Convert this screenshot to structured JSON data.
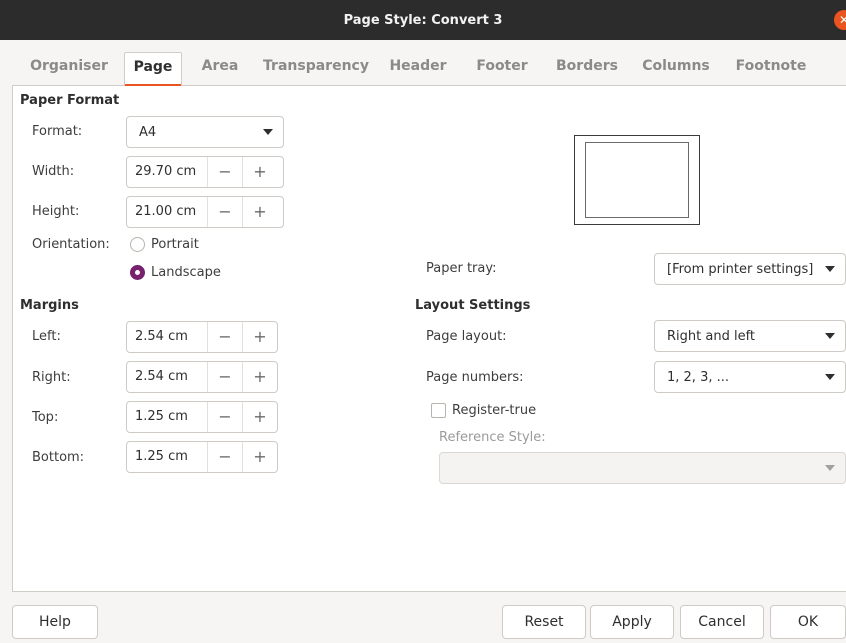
{
  "window": {
    "title": "Page Style: Convert 3"
  },
  "tabs": [
    "Organiser",
    "Page",
    "Area",
    "Transparency",
    "Header",
    "Footer",
    "Borders",
    "Columns",
    "Footnote"
  ],
  "active_tab": "Page",
  "paper_format": {
    "heading": "Paper Format",
    "format_label": "Format:",
    "format_value": "A4",
    "width_label": "Width:",
    "width_value": "29.70 cm",
    "height_label": "Height:",
    "height_value": "21.00 cm",
    "orientation_label": "Orientation:",
    "portrait_label": "Portrait",
    "landscape_label": "Landscape",
    "orientation_selected": "Landscape",
    "paper_tray_label": "Paper tray:",
    "paper_tray_value": "[From printer settings]"
  },
  "margins": {
    "heading": "Margins",
    "left_label": "Left:",
    "left_value": "2.54 cm",
    "right_label": "Right:",
    "right_value": "2.54 cm",
    "top_label": "Top:",
    "top_value": "1.25 cm",
    "bottom_label": "Bottom:",
    "bottom_value": "1.25 cm"
  },
  "layout_settings": {
    "heading": "Layout Settings",
    "page_layout_label": "Page layout:",
    "page_layout_value": "Right and left",
    "page_numbers_label": "Page numbers:",
    "page_numbers_value": "1, 2, 3, ...",
    "register_true_label": "Register-true",
    "register_true_checked": false,
    "reference_style_label": "Reference Style:",
    "reference_style_value": ""
  },
  "spin": {
    "minus": "−",
    "plus": "+"
  },
  "icons": {
    "close": "close-icon",
    "dropdown": "chevron-down-icon"
  },
  "buttons": {
    "help": "Help",
    "reset": "Reset",
    "apply": "Apply",
    "cancel": "Cancel",
    "ok": "OK"
  },
  "colors": {
    "accent": "#e95420",
    "radio_selected": "#77216f",
    "titlebar": "#2c2c2c"
  }
}
